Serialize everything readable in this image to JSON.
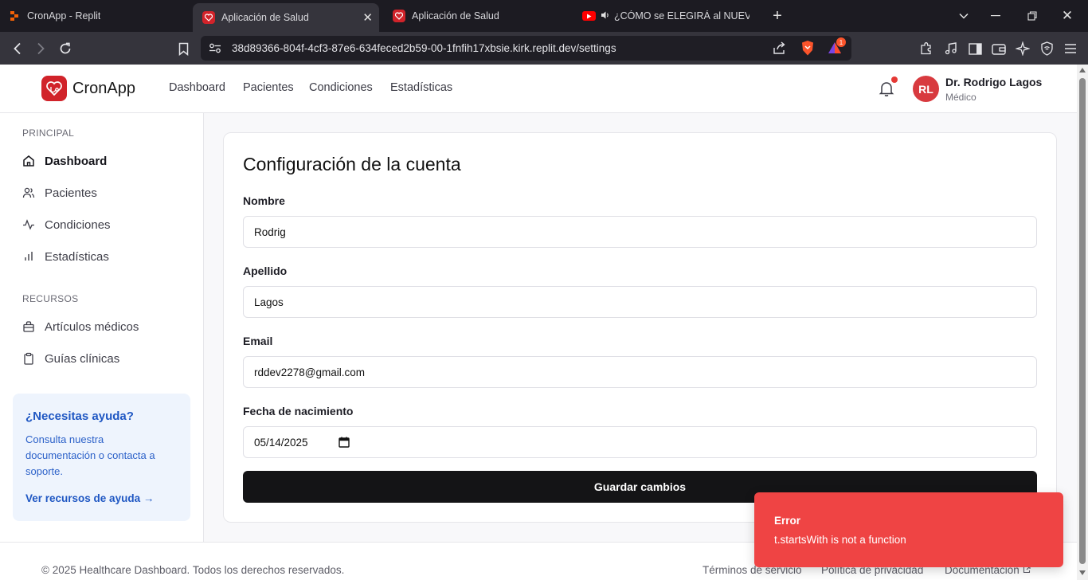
{
  "browser": {
    "tabs": [
      {
        "title": "CronApp - Replit",
        "active": false
      },
      {
        "title": "Aplicación de Salud",
        "active": true
      },
      {
        "title": "Aplicación de Salud",
        "active": false
      },
      {
        "title": "¿CÓMO se ELEGIRÁ al NUEVO P",
        "active": false
      }
    ],
    "url": "38d89366-804f-4cf3-87e6-634feced2b59-00-1fnfih17xbsie.kirk.replit.dev/settings",
    "shield_badge": "1"
  },
  "header": {
    "logo_text": "CronApp",
    "nav": [
      "Dashboard",
      "Pacientes",
      "Condiciones",
      "Estadísticas"
    ],
    "user": {
      "initials": "RL",
      "name": "Dr. Rodrigo Lagos",
      "role": "Médico"
    }
  },
  "sidebar": {
    "section_principal": "PRINCIPAL",
    "principal_items": [
      {
        "label": "Dashboard",
        "icon": "home-icon",
        "active": true
      },
      {
        "label": "Pacientes",
        "icon": "users-icon",
        "active": false
      },
      {
        "label": "Condiciones",
        "icon": "activity-icon",
        "active": false
      },
      {
        "label": "Estadísticas",
        "icon": "bar-chart-icon",
        "active": false
      }
    ],
    "section_recursos": "RECURSOS",
    "recursos_items": [
      {
        "label": "Artículos médicos",
        "icon": "briefcase-icon"
      },
      {
        "label": "Guías clínicas",
        "icon": "clipboard-icon"
      }
    ],
    "help": {
      "title": "¿Necesitas ayuda?",
      "body": "Consulta nuestra documentación o contacta a soporte.",
      "link": "Ver recursos de ayuda →"
    }
  },
  "settings": {
    "title": "Configuración de la cuenta",
    "nombre_label": "Nombre",
    "nombre_value": "Rodrig",
    "apellido_label": "Apellido",
    "apellido_value": "Lagos",
    "email_label": "Email",
    "email_value": "rddev2278@gmail.com",
    "fecha_label": "Fecha de nacimiento",
    "fecha_value": "05/14/2025",
    "save_label": "Guardar cambios"
  },
  "footer": {
    "copyright": "© 2025 Healthcare Dashboard. Todos los derechos reservados.",
    "terms": "Términos de servicio",
    "privacy": "Política de privacidad",
    "docs": "Documentación"
  },
  "toast": {
    "title": "Error",
    "message": "t.startsWith is not a function"
  },
  "colors": {
    "brand": "#d1232a",
    "toast_error": "#ef4444",
    "help_link": "#1f57c3",
    "button_dark": "#141416"
  }
}
